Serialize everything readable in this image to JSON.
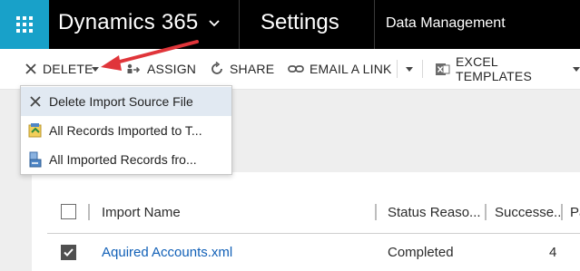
{
  "nav": {
    "app_name": "Dynamics 365",
    "module": "Settings",
    "breadcrumb": "Data Management",
    "waffle_color": "#18a1c9"
  },
  "commands": {
    "delete": "DELETE",
    "assign": "ASSIGN",
    "share": "SHARE",
    "email_link": "EMAIL A LINK",
    "excel_templates": "EXCEL TEMPLATES"
  },
  "delete_menu": {
    "items": [
      {
        "label": "Delete Import Source File",
        "icon": "x-icon"
      },
      {
        "label": "All Records Imported to T...",
        "icon": "imported-records-icon"
      },
      {
        "label": "All Imported Records fro...",
        "icon": "imported-records-list-icon"
      }
    ]
  },
  "grid": {
    "columns": [
      "Import Name",
      "Status Reaso...",
      "Successe...",
      "Pa"
    ],
    "rows": [
      {
        "name": "Aquired Accounts.xml",
        "status": "Completed",
        "successes": "4",
        "selected": true
      }
    ]
  },
  "annotation": {
    "arrow_color": "#e0353a"
  }
}
